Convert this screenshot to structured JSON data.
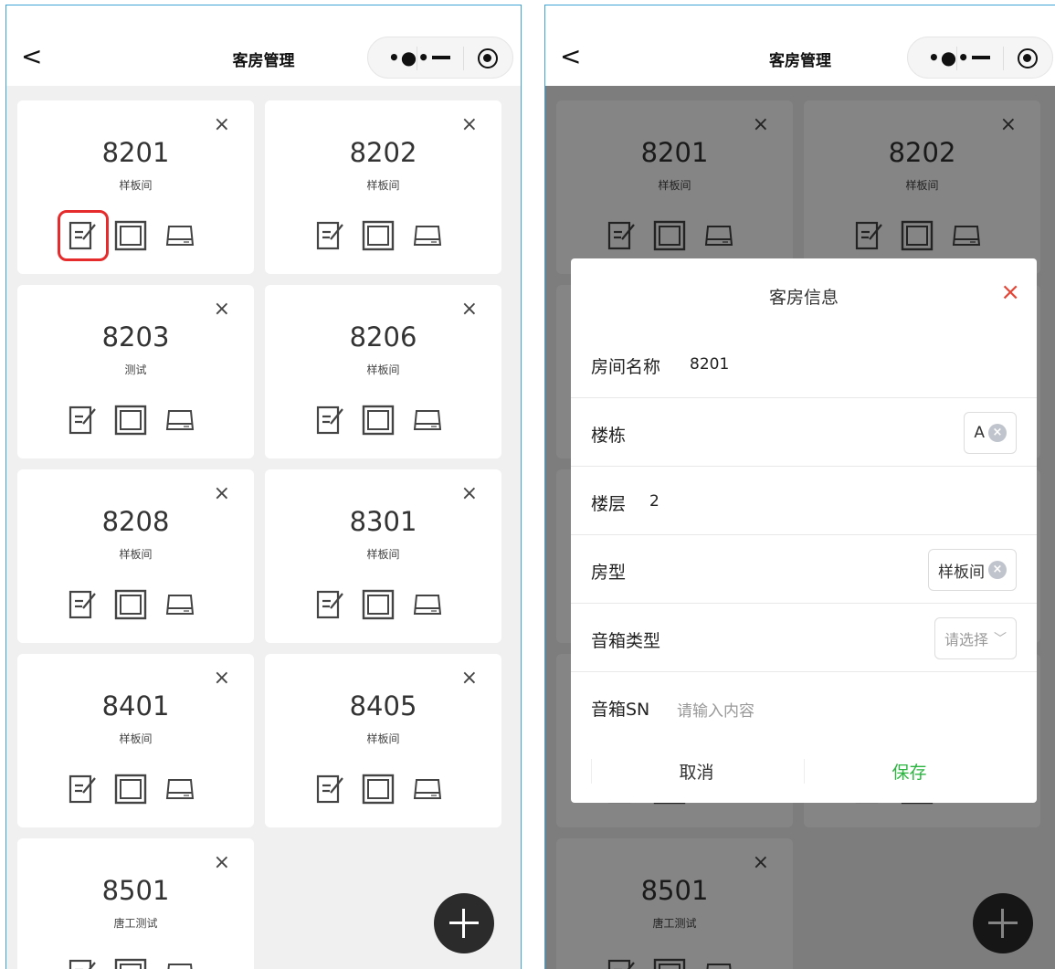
{
  "navbar": {
    "back": "<",
    "title": "客房管理",
    "more": "•●•"
  },
  "rooms": [
    {
      "number": "8201",
      "type": "样板间"
    },
    {
      "number": "8202",
      "type": "样板间"
    },
    {
      "number": "8203",
      "type": "测试"
    },
    {
      "number": "8206",
      "type": "样板间"
    },
    {
      "number": "8208",
      "type": "样板间"
    },
    {
      "number": "8301",
      "type": "样板间"
    },
    {
      "number": "8401",
      "type": "样板间"
    },
    {
      "number": "8405",
      "type": "样板间"
    },
    {
      "number": "8501",
      "type": "唐工测试"
    }
  ],
  "card_close": "×",
  "highlight_color": "#e52b2b",
  "modal": {
    "title": "客房信息",
    "close": "×",
    "room_name_label": "房间名称",
    "room_name_value": "8201",
    "building_label": "楼栋",
    "building_value": "A",
    "floor_label": "楼层",
    "floor_value": "2",
    "room_type_label": "房型",
    "room_type_value": "样板间",
    "speaker_type_label": "音箱类型",
    "speaker_type_placeholder": "请选择",
    "speaker_sn_label": "音箱SN",
    "speaker_sn_placeholder": "请输入内容",
    "cancel": "取消",
    "save": "保存",
    "save_color": "#2bb540"
  },
  "icons": [
    "edit-icon",
    "panel-icon",
    "device-box-icon",
    "plus-icon",
    "close-icon",
    "chevron-down-icon"
  ]
}
